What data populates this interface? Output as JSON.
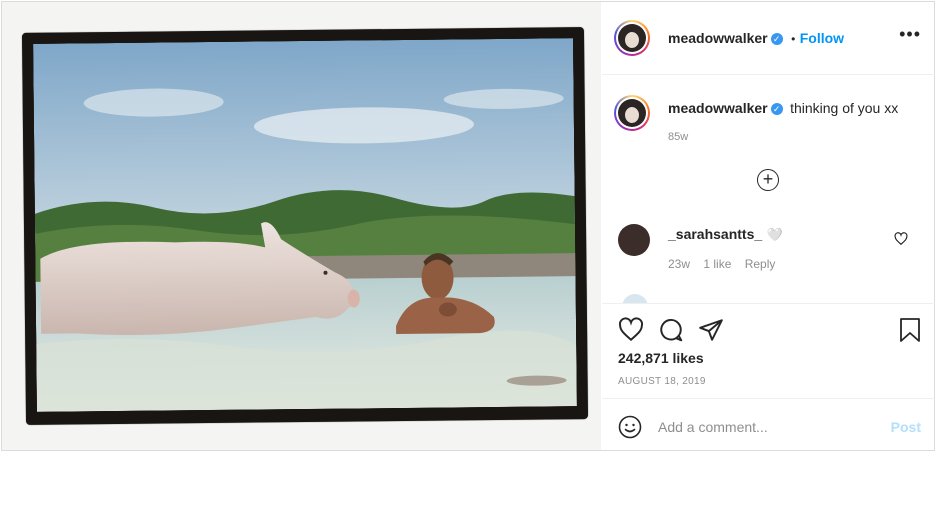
{
  "post": {
    "username": "meadowwalker",
    "follow_label": "Follow",
    "dot": "•",
    "more_glyph": "•••",
    "caption": "thinking of you xx",
    "caption_age": "85w",
    "load_more_glyph": "+"
  },
  "comments": [
    {
      "username": "_sarahsantts_",
      "emoji": "🤍",
      "age": "23w",
      "likes": "1 like",
      "reply": "Reply"
    }
  ],
  "actions": {
    "likes": "242,871 likes",
    "date": "AUGUST 18, 2019"
  },
  "composer": {
    "placeholder": "Add a comment...",
    "post_label": "Post"
  },
  "colors": {
    "link_blue": "#0095f6",
    "verified_blue": "#3897f0",
    "post_disabled": "#b2dffc"
  }
}
